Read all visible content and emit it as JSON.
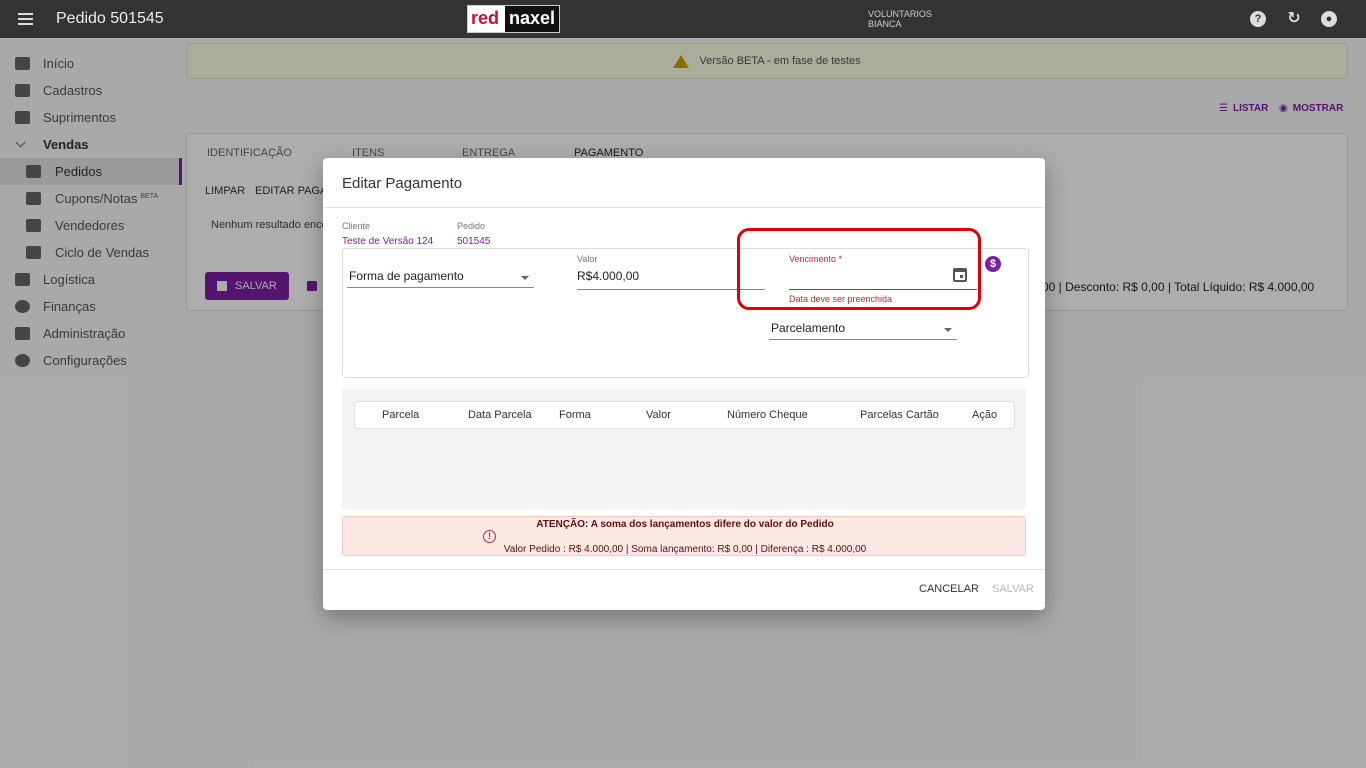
{
  "topbar": {
    "title": "Pedido 501545",
    "logo_left": "red",
    "logo_right": "naxel",
    "org": "VOLUNTARIOS",
    "user": "BIANCA",
    "help_icon": "help-icon",
    "refresh_icon": "refresh-icon",
    "account_icon": "account-icon"
  },
  "sidebar": {
    "items": [
      {
        "label": "Início",
        "icon": "home-icon"
      },
      {
        "label": "Cadastros",
        "icon": "folder-icon"
      },
      {
        "label": "Suprimentos",
        "icon": "briefcase-icon"
      },
      {
        "label": "Vendas",
        "icon": "chevron-down-icon"
      },
      {
        "label": "Pedidos",
        "icon": "list-icon"
      },
      {
        "label": "Cupons/Notas",
        "icon": "receipt-search-icon",
        "badge": "BETA"
      },
      {
        "label": "Vendedores",
        "icon": "contact-card-icon"
      },
      {
        "label": "Ciclo de Vendas",
        "icon": "infinity-icon"
      },
      {
        "label": "Logística",
        "icon": "route-icon"
      },
      {
        "label": "Finanças",
        "icon": "dollar-icon"
      },
      {
        "label": "Administração",
        "icon": "shield-icon"
      },
      {
        "label": "Configurações",
        "icon": "gear-icon"
      }
    ]
  },
  "main": {
    "beta_banner": "Versão BETA - em fase de testes",
    "listar": "LISTAR",
    "mostrar": "MOSTRAR",
    "tabs": [
      "IDENTIFICAÇÃO",
      "ITENS",
      "ENTREGA",
      "PAGAMENTO"
    ],
    "toolbar": {
      "limpar": "LIMPAR",
      "editar": "EDITAR PAGA"
    },
    "no_result": "Nenhum resultado enco",
    "save_label": "SALVAR",
    "totals": "00 | Desconto: R$ 0,00 | Total Líquido: R$ 4.000,00"
  },
  "dialog": {
    "title": "Editar Pagamento",
    "cliente_label": "Cliente",
    "cliente_value": "Teste de Versão 124",
    "pedido_label": "Pedido",
    "pedido_value": "501545",
    "forma_pagamento": "Forma de pagamento",
    "valor_label": "Valor",
    "valor_value": "R$4.000,00",
    "vencimento_label": "Vencimento *",
    "vencimento_value": "",
    "vencimento_error": "Data deve ser preenchida",
    "parcelamento": "Parcelamento",
    "columns": [
      "Parcela",
      "Data Parcela",
      "Forma",
      "Valor",
      "Número Cheque",
      "Parcelas Cartão",
      "Ação"
    ],
    "alert_title": "ATENÇÃO: A soma dos lançamentos difere do valor do Pedido",
    "alert_detail": "Valor Pedido : R$ 4.000,00 | Soma lançamento: R$ 0,00 | Diferença : R$ 4.000,00",
    "cancel_label": "CANCELAR",
    "save_label": "SALVAR"
  },
  "colors": {
    "accent": "#7b1fa2",
    "error": "#c62828",
    "highlight": "#e00000",
    "topbar": "#333333"
  }
}
